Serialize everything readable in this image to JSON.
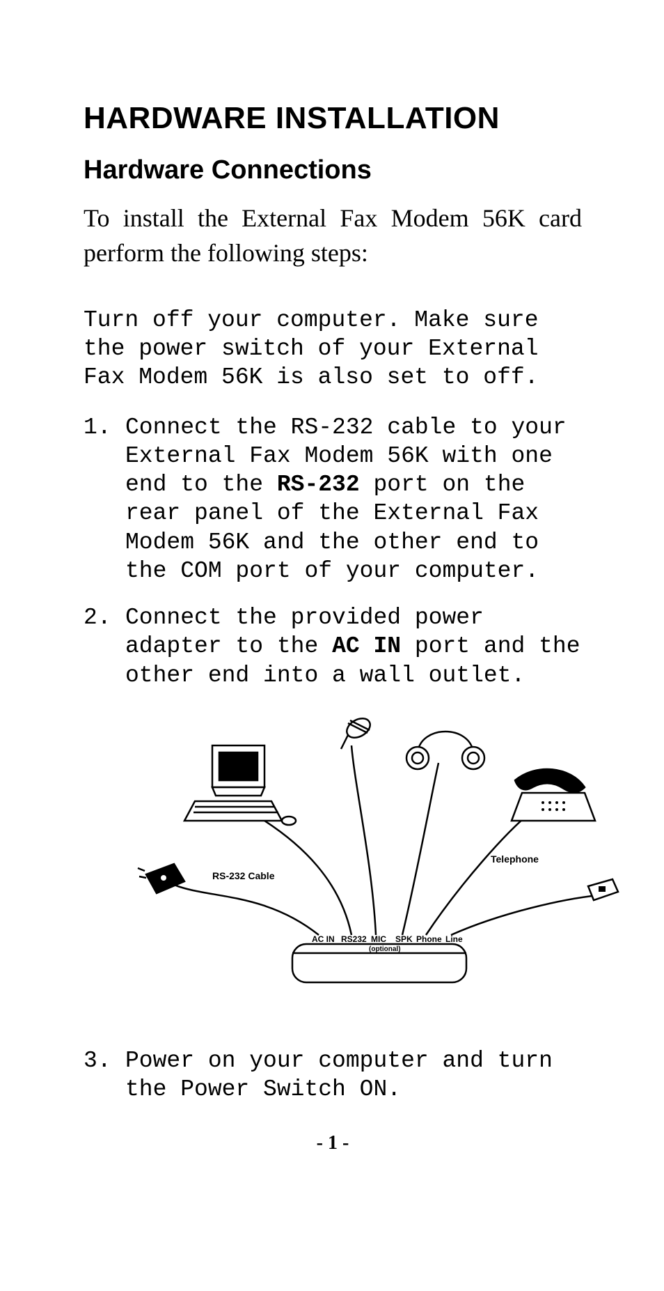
{
  "headings": {
    "title": "HARDWARE INSTALLATION",
    "subtitle": "Hardware Connections"
  },
  "intro": "To install the External Fax Modem 56K card perform the following steps:",
  "pre_step": "Turn off your computer. Make sure the power switch of your External Fax Modem 56K is also set to off.",
  "steps": {
    "s1a": "Connect the RS-232 cable to your External Fax Modem 56K with one end to the ",
    "s1b": "RS-232",
    "s1c": " port on the rear panel of the External Fax Modem 56K and the other end to the COM port of your computer.",
    "s2a": "Connect the provided power adapter to the ",
    "s2b": "AC IN",
    "s2c": " port and the other end into a wall outlet.",
    "s3": "Power on your computer and turn the Power Switch ON."
  },
  "figure": {
    "labels": {
      "rs232_cable": "RS-232 Cable",
      "telephone": "Telephone",
      "ac_in": "AC IN",
      "rs232": "RS232",
      "mic": "MIC",
      "spk": "SPK",
      "phone": "Phone",
      "line": "Line",
      "optional": "(optional)"
    }
  },
  "page_number": "- 1 -"
}
